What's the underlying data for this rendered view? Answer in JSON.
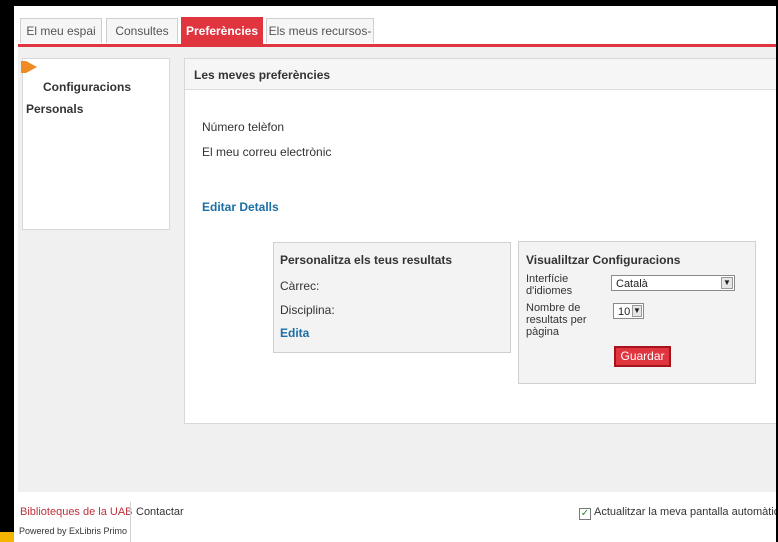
{
  "tabs": [
    {
      "label": "El meu espai"
    },
    {
      "label": "Consultes"
    },
    {
      "label": "Preferències"
    },
    {
      "label": "Els meus recursos-e"
    }
  ],
  "leftnav": {
    "items": [
      {
        "label": "Configuracions"
      },
      {
        "label": "Personals"
      }
    ]
  },
  "main": {
    "title": "Les meves preferències",
    "phone_label": "Número telèfon",
    "email_label": "El meu correu electrònic",
    "edit_details": "Editar Detalls"
  },
  "personalize": {
    "title": "Personalitza els teus resultats",
    "role_label": "Càrrec:",
    "discipline_label": "Disciplina:",
    "edit": "Edita"
  },
  "display": {
    "title": "Visualiltzar Configuracions",
    "language_label_1": "Interfície",
    "language_label_2": "d'idiomes",
    "language_value": "Català",
    "results_label_1": "Nombre de",
    "results_label_2": "resultats per",
    "results_label_3": "pàgina",
    "results_value": "10",
    "save": "Guardar"
  },
  "footer": {
    "library_link": "Biblioteques de la UAB",
    "contact_link": "Contactar",
    "powered_by": "Powered by ExLibris Primo",
    "auto_update_label": "Actualitzar la meva pantalla automàticament",
    "auto_update_checked": true
  },
  "colors": {
    "accent": "#e0353f",
    "link": "#1c6fa6",
    "nav_arrow": "#f08a24"
  }
}
